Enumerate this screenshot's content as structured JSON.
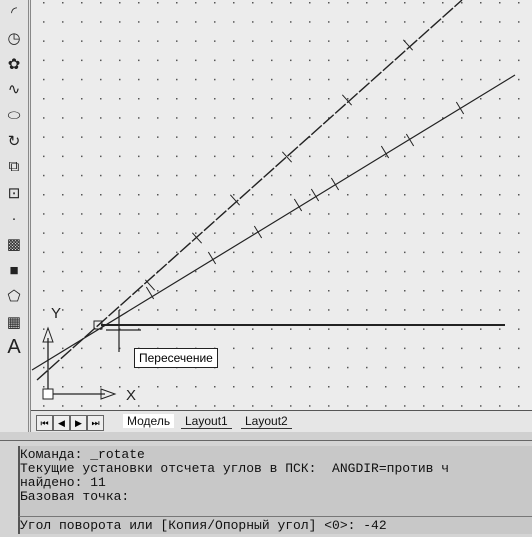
{
  "toolbar": {
    "items": [
      {
        "icon": "arc-icon"
      },
      {
        "icon": "circle-icon"
      },
      {
        "icon": "revcloud-icon"
      },
      {
        "icon": "spline-icon"
      },
      {
        "icon": "ellipse-icon"
      },
      {
        "icon": "ellipse-arc-icon"
      },
      {
        "icon": "insert-block-icon"
      },
      {
        "icon": "make-block-icon"
      },
      {
        "icon": "point-icon"
      },
      {
        "icon": "hatch-icon"
      },
      {
        "icon": "gradient-icon"
      },
      {
        "icon": "region-icon"
      },
      {
        "icon": "table-icon"
      },
      {
        "icon": "multiline-text-icon",
        "glyph": "A"
      }
    ]
  },
  "canvas": {
    "ucs": {
      "x_label": "X",
      "y_label": "Y"
    },
    "tooltip": "Пересечение"
  },
  "tabs": {
    "items": [
      "Модель",
      "Layout1",
      "Layout2"
    ],
    "active": 0
  },
  "command": {
    "history": [
      "Команда: _rotate",
      "Текущие установки отсчета углов в ПСК:  ANGDIR=против ч",
      "найдено: 11",
      "Базовая точка:"
    ],
    "prompt": "Угол поворота или [Копия/Опорный угол] <0>: -42"
  },
  "colors": {
    "canvas": "#ececec",
    "line": "#222222",
    "grid": "#555555"
  }
}
